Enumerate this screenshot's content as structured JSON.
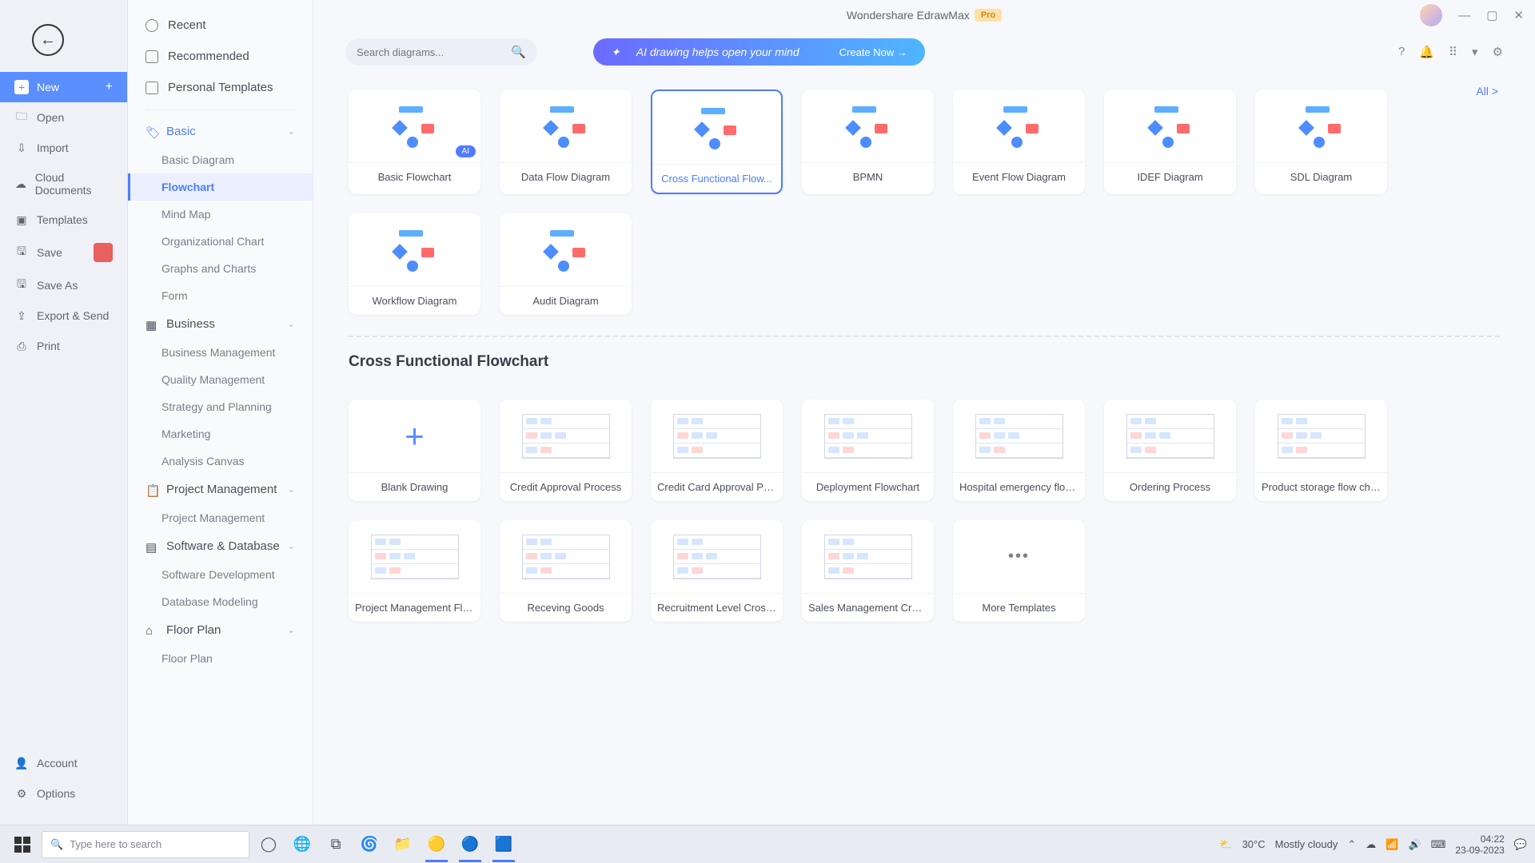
{
  "title": {
    "app": "Wondershare EdrawMax",
    "badge": "Pro"
  },
  "window_controls": {
    "min": "—",
    "max": "▢",
    "close": "✕"
  },
  "far_nav": {
    "back": "←",
    "items": [
      {
        "label": "New",
        "icon": "+",
        "plus": "+",
        "active": true
      },
      {
        "label": "Open",
        "icon": "🗀"
      },
      {
        "label": "Import",
        "icon": "⇩"
      },
      {
        "label": "Cloud Documents",
        "icon": "☁"
      },
      {
        "label": "Templates",
        "icon": "▣"
      },
      {
        "label": "Save",
        "icon": "🖫",
        "notif": true
      },
      {
        "label": "Save As",
        "icon": "🖫"
      },
      {
        "label": "Export & Send",
        "icon": "⇪"
      },
      {
        "label": "Print",
        "icon": "⎙"
      }
    ],
    "bottom": [
      {
        "label": "Account",
        "icon": "👤"
      },
      {
        "label": "Options",
        "icon": "⚙"
      }
    ]
  },
  "cat_top": [
    {
      "label": "Recent",
      "icon": "clock"
    },
    {
      "label": "Recommended",
      "icon": "star"
    },
    {
      "label": "Personal Templates",
      "icon": "doc"
    }
  ],
  "cat_groups": {
    "g0": {
      "label": "Basic",
      "icon": "🏷",
      "expanded": true,
      "subs": [
        "Basic Diagram",
        "Flowchart",
        "Mind Map",
        "Organizational Chart",
        "Graphs and Charts",
        "Form"
      ],
      "active_sub": 1
    },
    "g1": {
      "label": "Business",
      "icon": "▦",
      "subs": [
        "Business Management",
        "Quality Management",
        "Strategy and Planning",
        "Marketing",
        "Analysis Canvas"
      ]
    },
    "g2": {
      "label": "Project Management",
      "icon": "📋",
      "subs": [
        "Project Management"
      ]
    },
    "g3": {
      "label": "Software & Database",
      "icon": "▤",
      "subs": [
        "Software Development",
        "Database Modeling"
      ]
    },
    "g4": {
      "label": "Floor Plan",
      "icon": "⌂",
      "subs": [
        "Floor Plan"
      ]
    }
  },
  "search": {
    "placeholder": "Search diagrams..."
  },
  "ai_banner": {
    "text": "AI drawing helps open your mind",
    "action": "Create Now  →"
  },
  "all_link": "All  >",
  "toolbar_icons": {
    "help": "?",
    "bell": "🔔",
    "apps": "⠿",
    "view": "▾",
    "gear": "⚙"
  },
  "diagram_types": [
    {
      "label": "Basic Flowchart",
      "kind": "basic",
      "ai": true
    },
    {
      "label": "Data Flow Diagram",
      "kind": "dfd"
    },
    {
      "label": "Cross Functional Flow...",
      "kind": "cross",
      "selected": true
    },
    {
      "label": "BPMN",
      "kind": "bpmn"
    },
    {
      "label": "Event Flow Diagram",
      "kind": "event"
    },
    {
      "label": "IDEF Diagram",
      "kind": "idef"
    },
    {
      "label": "SDL Diagram",
      "kind": "sdl"
    },
    {
      "label": "Workflow Diagram",
      "kind": "workflow"
    },
    {
      "label": "Audit Diagram",
      "kind": "audit"
    }
  ],
  "section_title": "Cross Functional Flowchart",
  "cross_templates": [
    {
      "label": "Blank Drawing",
      "kind": "blank"
    },
    {
      "label": "Credit Approval Process"
    },
    {
      "label": "Credit Card Approval Proc..."
    },
    {
      "label": "Deployment Flowchart"
    },
    {
      "label": "Hospital emergency flow c..."
    },
    {
      "label": "Ordering Process"
    },
    {
      "label": "Product storage flow chart"
    },
    {
      "label": "Project Management Flow..."
    },
    {
      "label": "Receving Goods"
    },
    {
      "label": "Recruitment Level Cross F..."
    },
    {
      "label": "Sales Management Crossf..."
    },
    {
      "label": "More Templates",
      "kind": "more"
    }
  ],
  "taskbar": {
    "search": "Type here to search",
    "weather_temp": "30°C",
    "weather_text": "Mostly cloudy",
    "time": "04:22",
    "date": "23-09-2023"
  }
}
